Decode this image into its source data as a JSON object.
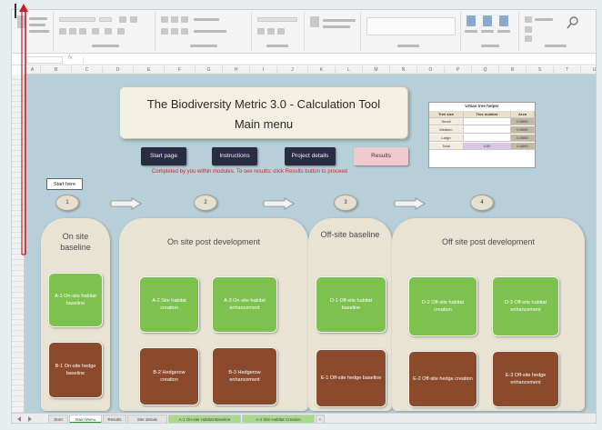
{
  "sheet": {
    "title_line1": "The Biodiversity Metric 3.0 - Calculation Tool",
    "title_line2": "Main menu",
    "nav_buttons": [
      "Start page",
      "Instructions",
      "Project details",
      "Results"
    ],
    "note": "Completed by you within modules. To see results: click Results button to proceed",
    "start_here": "Start here",
    "steps": [
      "1",
      "2",
      "3",
      "4"
    ],
    "panels": {
      "p1": "On site baseline",
      "p2": "On site post development",
      "p3": "Off-site baseline",
      "p4": "Off site post development"
    },
    "tiles": {
      "a1": "A-1 On-site habitat baseline",
      "b1": "B-1 On-site hedge baseline",
      "a2": "A-2 Site habitat creation",
      "a3": "A-3 On-site habitat enhancement",
      "b2": "B-2 Hedgerow creation",
      "b3": "B-3 Hedgerow enhancement",
      "d1": "D-1 Off-site habitat baseline",
      "e1": "E-1 Off-site hedge baseline",
      "d2": "D-2 Off-site habitat creation",
      "d3": "D-3 Off-site habitat enhancement",
      "e2": "E-2 Off-site hedge creation",
      "e3": "E-3 Off-site hedge enhancement"
    },
    "tree_helper": {
      "title": "Urban tree helper",
      "headers": [
        "Tree size",
        "Tree number",
        "Area"
      ],
      "rows": [
        [
          "Small",
          "",
          "0.0000"
        ],
        [
          "Medium",
          "",
          "0.0000"
        ],
        [
          "Large",
          "",
          "0.0000"
        ],
        [
          "Total",
          "0.00",
          "0.0000"
        ]
      ]
    }
  },
  "columns": [
    "A",
    "B",
    "C",
    "D",
    "E",
    "F",
    "G",
    "H",
    "I",
    "J",
    "K",
    "L",
    "M",
    "N",
    "O",
    "P",
    "Q",
    "R",
    "S",
    "T",
    "U"
  ],
  "tabs": [
    "Start",
    "Main Menu",
    "Results",
    "Site details",
    "A-1 On-site Habitat Baseline",
    "A-2 Site Habitat Creation"
  ]
}
